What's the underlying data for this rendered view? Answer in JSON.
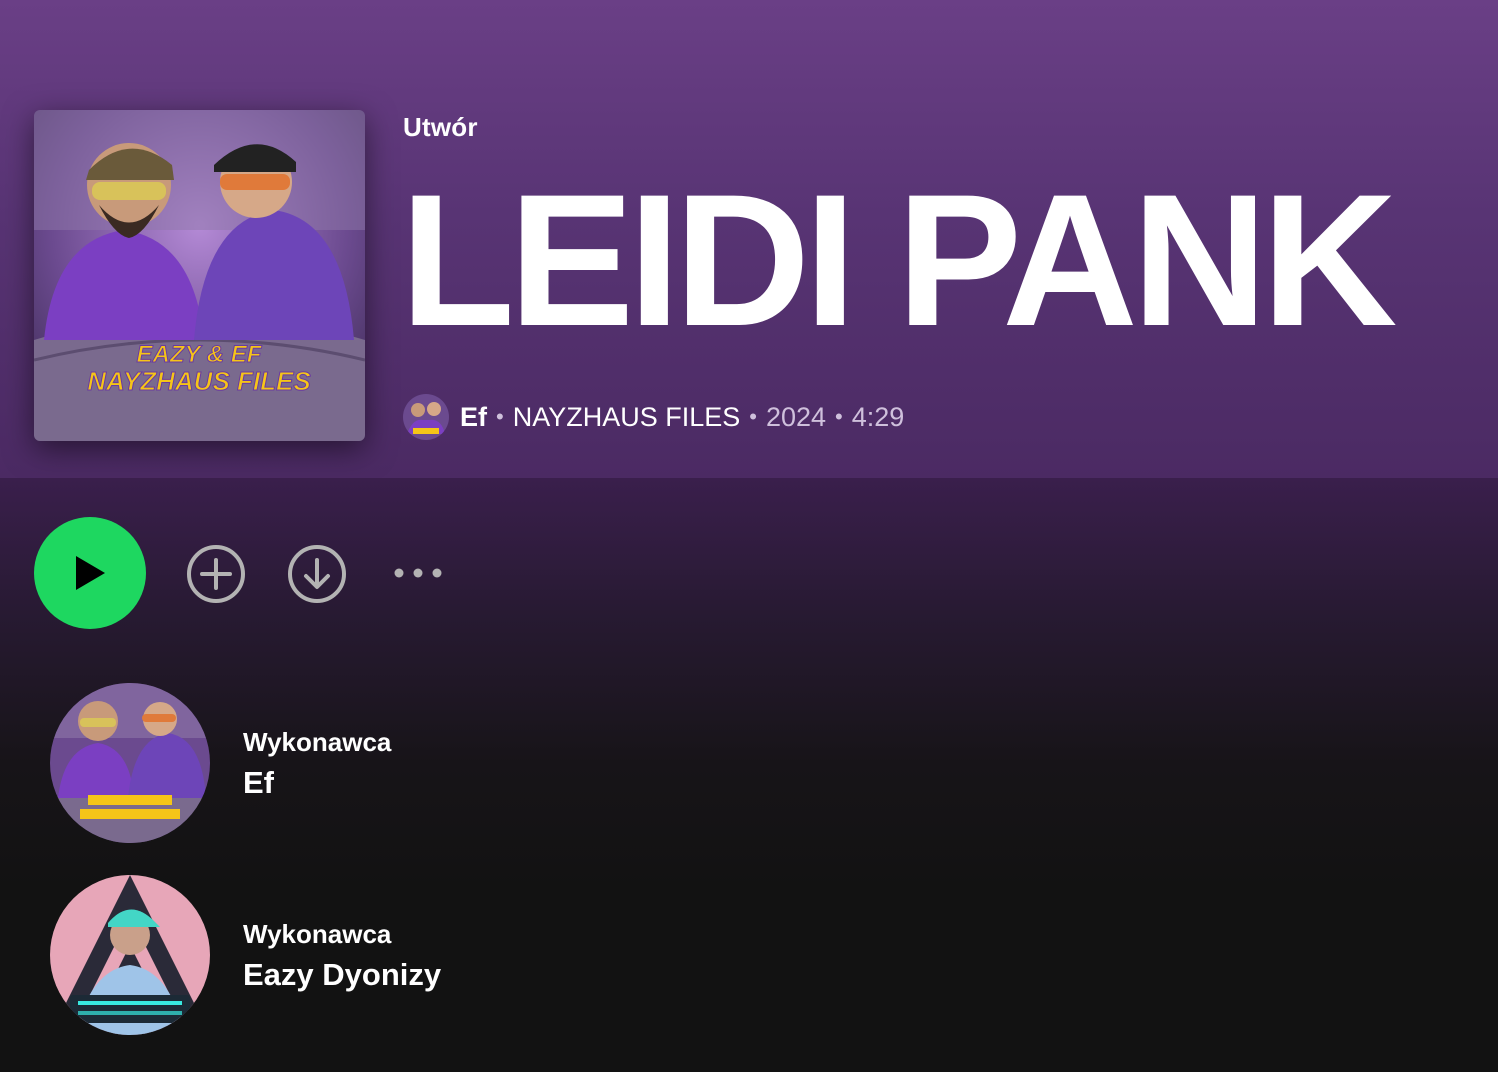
{
  "header": {
    "type_label": "Utwór",
    "title": "LEIDI PANK",
    "artist": "Ef",
    "album": "NAYZHAUS FILES",
    "year": "2024",
    "duration": "4:29",
    "cover_text_line1": "EAZY & EF",
    "cover_text_line2": "NAYZHAUS FILES"
  },
  "actions": {
    "play_icon": "play-icon",
    "add_icon": "plus-circle-icon",
    "download_icon": "download-circle-icon",
    "more_icon": "more-dots-icon"
  },
  "artists": [
    {
      "role": "Wykonawca",
      "name": "Ef"
    },
    {
      "role": "Wykonawca",
      "name": "Eazy Dyonizy"
    }
  ],
  "colors": {
    "accent_green": "#1ed760",
    "header_purple": "#5e3779",
    "background": "#121212"
  }
}
